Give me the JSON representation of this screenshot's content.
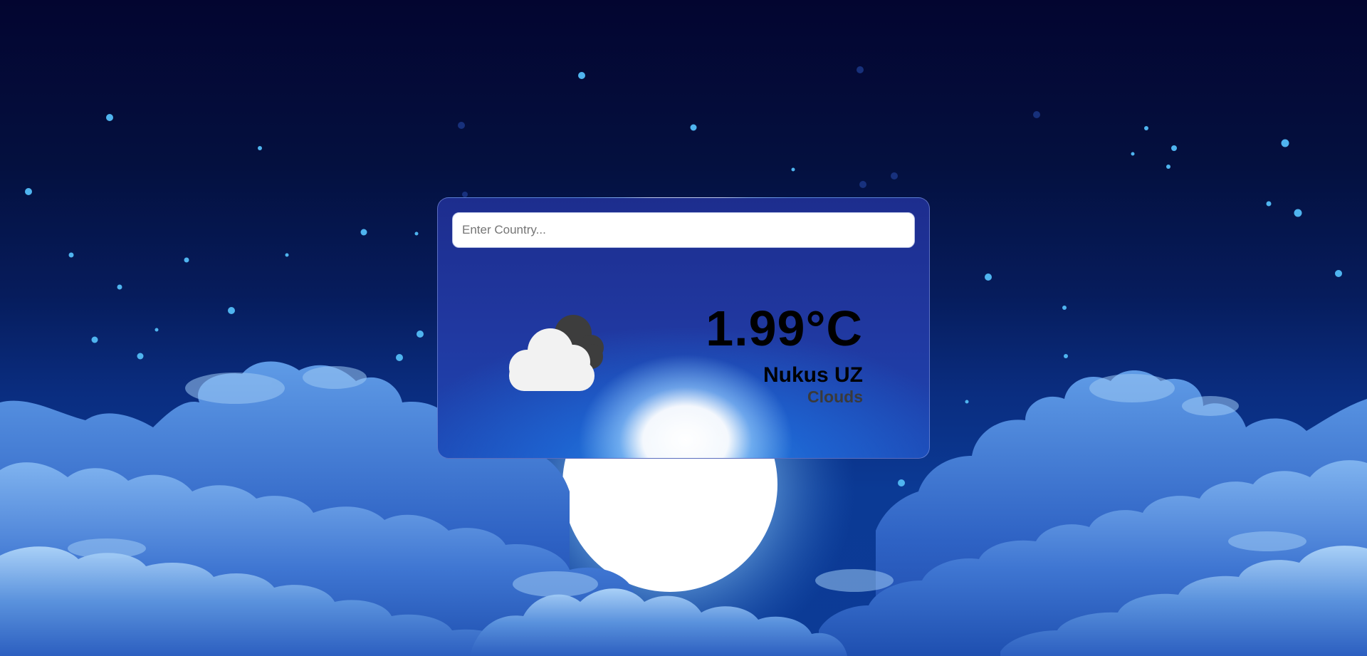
{
  "search": {
    "placeholder": "Enter Country...",
    "value": ""
  },
  "weather": {
    "temperature": "1.99°C",
    "location": "Nukus UZ",
    "condition": "Clouds",
    "icon": "clouds-icon"
  },
  "colors": {
    "sky_top": "#030530",
    "sky_bottom": "#0c3b96",
    "card_top": "#1d2d8e",
    "moon": "#ffffff",
    "star": "#4fb4ef"
  }
}
